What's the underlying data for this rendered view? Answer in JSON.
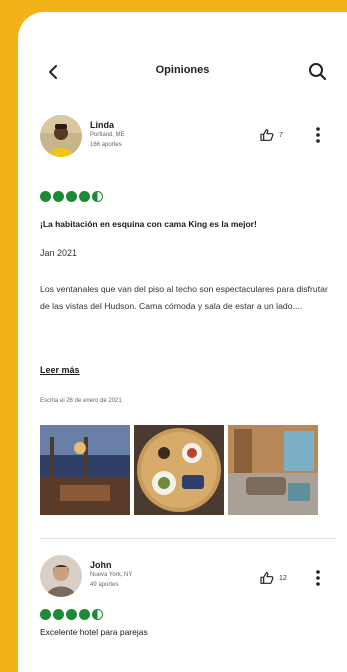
{
  "header": {
    "title": "Opiniones",
    "back_icon": "chevron-left-icon",
    "search_icon": "search-icon"
  },
  "colors": {
    "background": "#f2b21a",
    "rating_green": "#1c8a36"
  },
  "reviews": [
    {
      "user_name": "Linda",
      "location": "Portland, ME",
      "contributions": "166 aportes",
      "likes": "7",
      "rating": 4.5,
      "title": "¡La habitación en esquina con cama King es la mejor!",
      "date": "Jan 2021",
      "body": "Los ventanales que van del piso al techo son espectaculares para disfrutar de las vistas del Hudson. Cama cómoda y sala de estar a un lado....",
      "read_more": "Leer más",
      "written": "Escrita el 26 de enero de 2021",
      "photos": [
        "hotel-room-city-view-photo",
        "breakfast-tray-photo",
        "hotel-living-room-photo"
      ]
    },
    {
      "user_name": "John",
      "location": "Nueva York, NY",
      "contributions": "49 aportes",
      "likes": "12",
      "rating": 4.5,
      "title": "Excelente hotel para parejas"
    }
  ]
}
